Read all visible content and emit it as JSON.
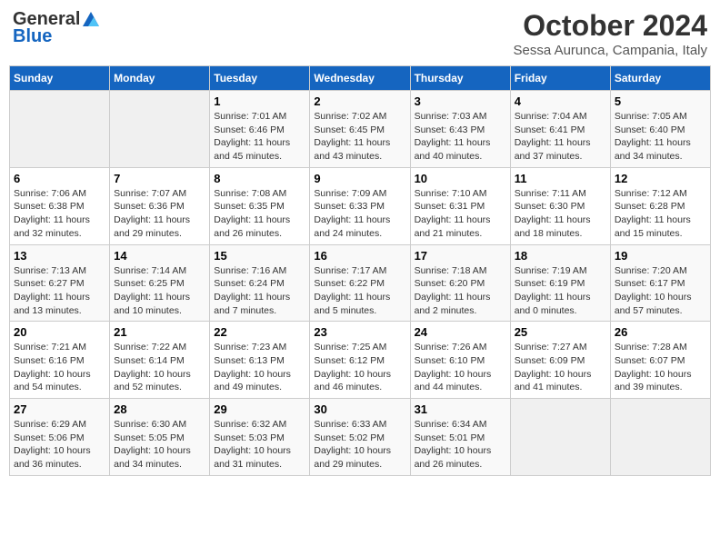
{
  "header": {
    "logo_general": "General",
    "logo_blue": "Blue",
    "month_title": "October 2024",
    "location": "Sessa Aurunca, Campania, Italy"
  },
  "weekdays": [
    "Sunday",
    "Monday",
    "Tuesday",
    "Wednesday",
    "Thursday",
    "Friday",
    "Saturday"
  ],
  "weeks": [
    [
      {
        "day": "",
        "empty": true
      },
      {
        "day": "",
        "empty": true
      },
      {
        "day": "1",
        "sunrise": "Sunrise: 7:01 AM",
        "sunset": "Sunset: 6:46 PM",
        "daylight": "Daylight: 11 hours and 45 minutes."
      },
      {
        "day": "2",
        "sunrise": "Sunrise: 7:02 AM",
        "sunset": "Sunset: 6:45 PM",
        "daylight": "Daylight: 11 hours and 43 minutes."
      },
      {
        "day": "3",
        "sunrise": "Sunrise: 7:03 AM",
        "sunset": "Sunset: 6:43 PM",
        "daylight": "Daylight: 11 hours and 40 minutes."
      },
      {
        "day": "4",
        "sunrise": "Sunrise: 7:04 AM",
        "sunset": "Sunset: 6:41 PM",
        "daylight": "Daylight: 11 hours and 37 minutes."
      },
      {
        "day": "5",
        "sunrise": "Sunrise: 7:05 AM",
        "sunset": "Sunset: 6:40 PM",
        "daylight": "Daylight: 11 hours and 34 minutes."
      }
    ],
    [
      {
        "day": "6",
        "sunrise": "Sunrise: 7:06 AM",
        "sunset": "Sunset: 6:38 PM",
        "daylight": "Daylight: 11 hours and 32 minutes."
      },
      {
        "day": "7",
        "sunrise": "Sunrise: 7:07 AM",
        "sunset": "Sunset: 6:36 PM",
        "daylight": "Daylight: 11 hours and 29 minutes."
      },
      {
        "day": "8",
        "sunrise": "Sunrise: 7:08 AM",
        "sunset": "Sunset: 6:35 PM",
        "daylight": "Daylight: 11 hours and 26 minutes."
      },
      {
        "day": "9",
        "sunrise": "Sunrise: 7:09 AM",
        "sunset": "Sunset: 6:33 PM",
        "daylight": "Daylight: 11 hours and 24 minutes."
      },
      {
        "day": "10",
        "sunrise": "Sunrise: 7:10 AM",
        "sunset": "Sunset: 6:31 PM",
        "daylight": "Daylight: 11 hours and 21 minutes."
      },
      {
        "day": "11",
        "sunrise": "Sunrise: 7:11 AM",
        "sunset": "Sunset: 6:30 PM",
        "daylight": "Daylight: 11 hours and 18 minutes."
      },
      {
        "day": "12",
        "sunrise": "Sunrise: 7:12 AM",
        "sunset": "Sunset: 6:28 PM",
        "daylight": "Daylight: 11 hours and 15 minutes."
      }
    ],
    [
      {
        "day": "13",
        "sunrise": "Sunrise: 7:13 AM",
        "sunset": "Sunset: 6:27 PM",
        "daylight": "Daylight: 11 hours and 13 minutes."
      },
      {
        "day": "14",
        "sunrise": "Sunrise: 7:14 AM",
        "sunset": "Sunset: 6:25 PM",
        "daylight": "Daylight: 11 hours and 10 minutes."
      },
      {
        "day": "15",
        "sunrise": "Sunrise: 7:16 AM",
        "sunset": "Sunset: 6:24 PM",
        "daylight": "Daylight: 11 hours and 7 minutes."
      },
      {
        "day": "16",
        "sunrise": "Sunrise: 7:17 AM",
        "sunset": "Sunset: 6:22 PM",
        "daylight": "Daylight: 11 hours and 5 minutes."
      },
      {
        "day": "17",
        "sunrise": "Sunrise: 7:18 AM",
        "sunset": "Sunset: 6:20 PM",
        "daylight": "Daylight: 11 hours and 2 minutes."
      },
      {
        "day": "18",
        "sunrise": "Sunrise: 7:19 AM",
        "sunset": "Sunset: 6:19 PM",
        "daylight": "Daylight: 11 hours and 0 minutes."
      },
      {
        "day": "19",
        "sunrise": "Sunrise: 7:20 AM",
        "sunset": "Sunset: 6:17 PM",
        "daylight": "Daylight: 10 hours and 57 minutes."
      }
    ],
    [
      {
        "day": "20",
        "sunrise": "Sunrise: 7:21 AM",
        "sunset": "Sunset: 6:16 PM",
        "daylight": "Daylight: 10 hours and 54 minutes."
      },
      {
        "day": "21",
        "sunrise": "Sunrise: 7:22 AM",
        "sunset": "Sunset: 6:14 PM",
        "daylight": "Daylight: 10 hours and 52 minutes."
      },
      {
        "day": "22",
        "sunrise": "Sunrise: 7:23 AM",
        "sunset": "Sunset: 6:13 PM",
        "daylight": "Daylight: 10 hours and 49 minutes."
      },
      {
        "day": "23",
        "sunrise": "Sunrise: 7:25 AM",
        "sunset": "Sunset: 6:12 PM",
        "daylight": "Daylight: 10 hours and 46 minutes."
      },
      {
        "day": "24",
        "sunrise": "Sunrise: 7:26 AM",
        "sunset": "Sunset: 6:10 PM",
        "daylight": "Daylight: 10 hours and 44 minutes."
      },
      {
        "day": "25",
        "sunrise": "Sunrise: 7:27 AM",
        "sunset": "Sunset: 6:09 PM",
        "daylight": "Daylight: 10 hours and 41 minutes."
      },
      {
        "day": "26",
        "sunrise": "Sunrise: 7:28 AM",
        "sunset": "Sunset: 6:07 PM",
        "daylight": "Daylight: 10 hours and 39 minutes."
      }
    ],
    [
      {
        "day": "27",
        "sunrise": "Sunrise: 6:29 AM",
        "sunset": "Sunset: 5:06 PM",
        "daylight": "Daylight: 10 hours and 36 minutes."
      },
      {
        "day": "28",
        "sunrise": "Sunrise: 6:30 AM",
        "sunset": "Sunset: 5:05 PM",
        "daylight": "Daylight: 10 hours and 34 minutes."
      },
      {
        "day": "29",
        "sunrise": "Sunrise: 6:32 AM",
        "sunset": "Sunset: 5:03 PM",
        "daylight": "Daylight: 10 hours and 31 minutes."
      },
      {
        "day": "30",
        "sunrise": "Sunrise: 6:33 AM",
        "sunset": "Sunset: 5:02 PM",
        "daylight": "Daylight: 10 hours and 29 minutes."
      },
      {
        "day": "31",
        "sunrise": "Sunrise: 6:34 AM",
        "sunset": "Sunset: 5:01 PM",
        "daylight": "Daylight: 10 hours and 26 minutes."
      },
      {
        "day": "",
        "empty": true
      },
      {
        "day": "",
        "empty": true
      }
    ]
  ]
}
